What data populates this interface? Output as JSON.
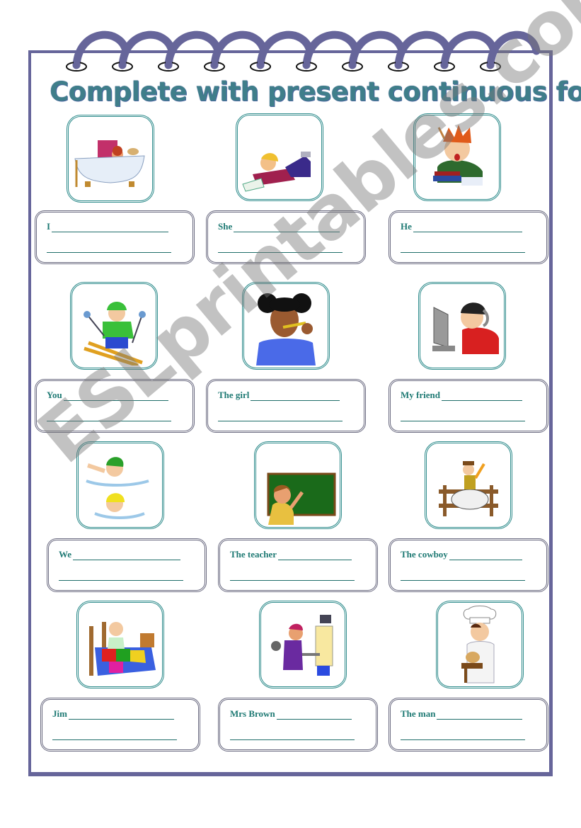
{
  "worksheet": {
    "title": "Complete with present continuous forms.",
    "watermark": "ESLprintables.com",
    "colors": {
      "border": "#66659a",
      "frame": "#2f8c8c",
      "subject_text": "#1f7a74",
      "title": "#3f7e8a"
    },
    "items": [
      {
        "subject": "I",
        "picture": "child-in-bathtub"
      },
      {
        "subject": "She",
        "picture": "girl-reading-book"
      },
      {
        "subject": "He",
        "picture": "boy-studying-books"
      },
      {
        "subject": "You",
        "picture": "boy-skiing"
      },
      {
        "subject": "The girl",
        "picture": "girl-brushing-teeth"
      },
      {
        "subject": "My friend",
        "picture": "boy-using-computer"
      },
      {
        "subject": "We",
        "picture": "kids-swimming"
      },
      {
        "subject": "The teacher",
        "picture": "teacher-at-blackboard"
      },
      {
        "subject": "The cowboy",
        "picture": "cowboy-riding-horse"
      },
      {
        "subject": "Jim",
        "picture": "boy-waking-up-in-bed"
      },
      {
        "subject": "Mrs Brown",
        "picture": "woman-ironing"
      },
      {
        "subject": "The man",
        "picture": "chef-cooking"
      }
    ]
  }
}
